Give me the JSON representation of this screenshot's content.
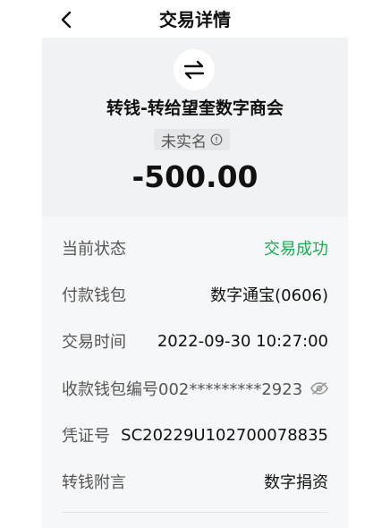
{
  "header": {
    "title": "交易详情"
  },
  "transaction": {
    "name": "转钱-转给望奎数字商会",
    "badge_label": "未实名",
    "amount": "-500.00"
  },
  "details": [
    {
      "label": "当前状态",
      "value": "交易成功"
    },
    {
      "label": "付款钱包",
      "value": "数字通宝(0606)"
    },
    {
      "label": "交易时间",
      "value": "2022-09-30 10:27:00"
    },
    {
      "label": "收款钱包编号",
      "value": "002*********2923"
    },
    {
      "label": "凭证号",
      "value": "SC20229U102700078835"
    },
    {
      "label": "转钱附言",
      "value": "数字捐资"
    }
  ],
  "colors": {
    "success": "#1aad53",
    "panel_bg": "#f1f2f4"
  },
  "icons": {
    "back": "chevron-left-icon",
    "transfer": "transfer-arrows-icon",
    "info": "info-circle-icon",
    "eye": "eye-hidden-icon"
  }
}
